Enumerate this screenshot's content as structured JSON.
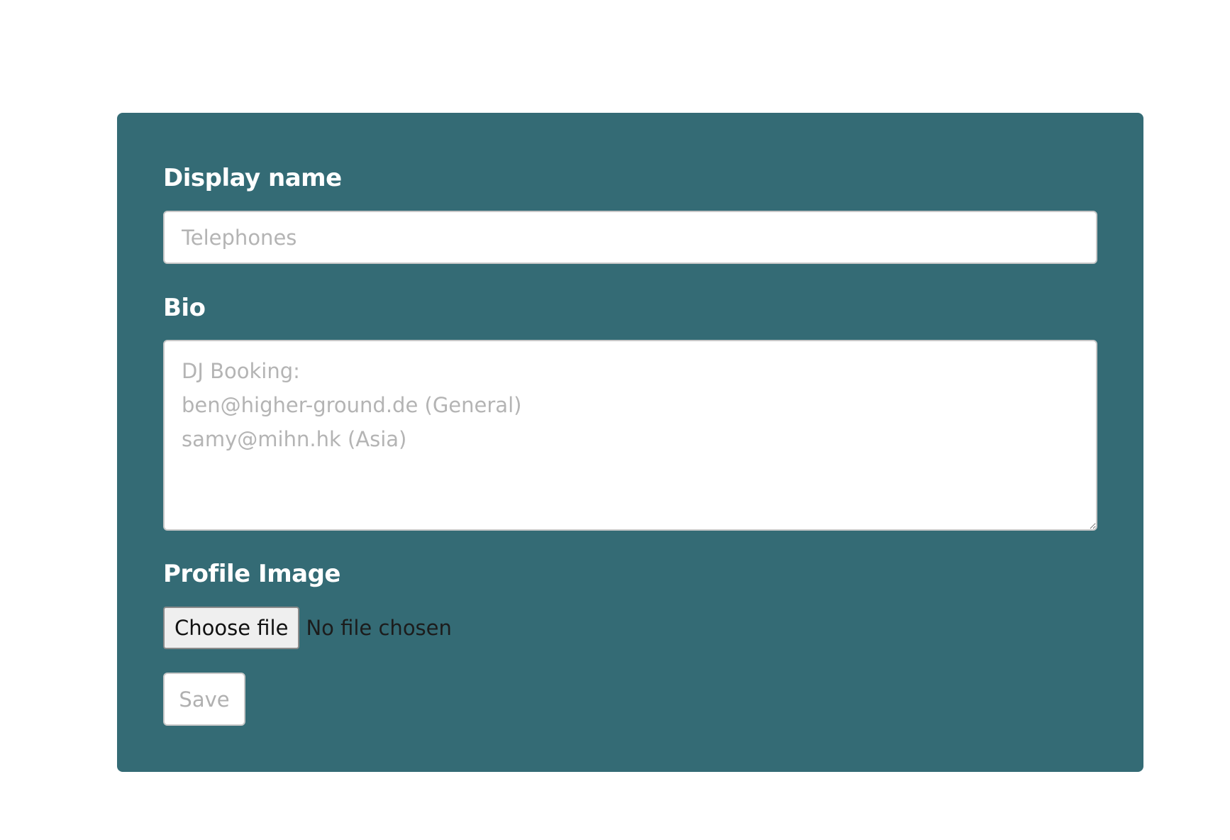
{
  "form": {
    "display_name": {
      "label": "Display name",
      "value": "",
      "placeholder": "Telephones"
    },
    "bio": {
      "label": "Bio",
      "value": "",
      "placeholder": "DJ Booking:\nben@higher-ground.de (General)\nsamy@mihn.hk (Asia)"
    },
    "profile_image": {
      "label": "Profile Image",
      "choose_button_label": "Choose file",
      "status_text": "No file chosen"
    },
    "save_label": "Save"
  },
  "colors": {
    "panel_background": "#346b75",
    "label_text": "#ffffff",
    "page_background": "#ffffff"
  }
}
